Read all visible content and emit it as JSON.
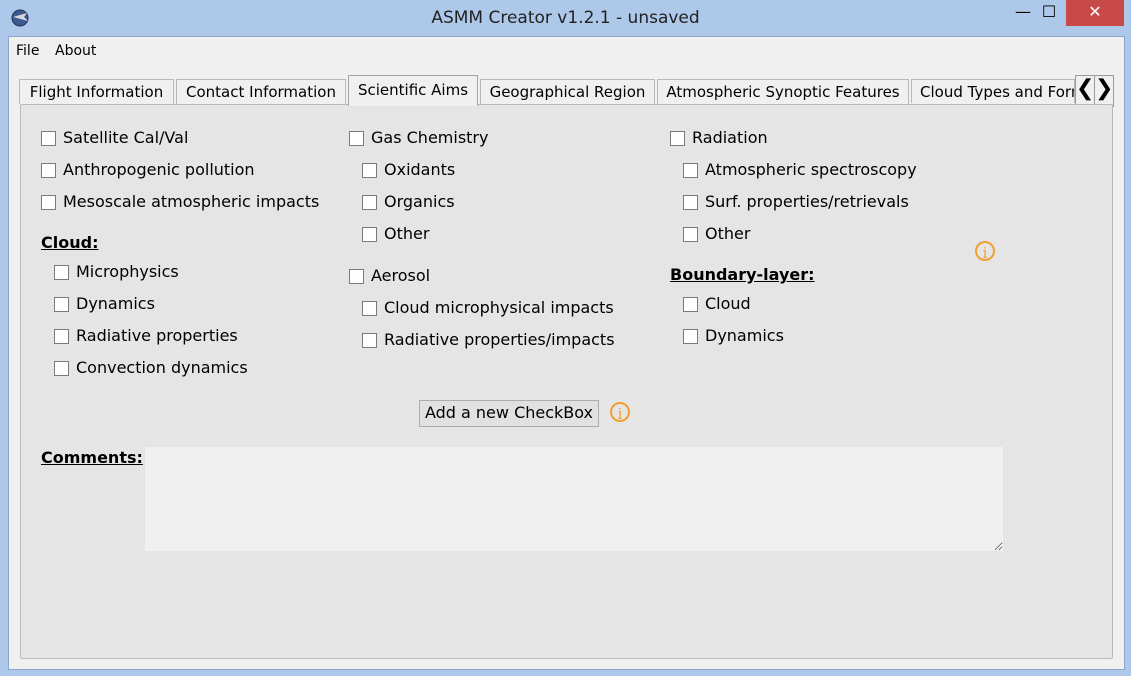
{
  "window": {
    "title": "ASMM Creator v1.2.1 - unsaved",
    "minimize": "—",
    "maximize": "☐",
    "close": "✕"
  },
  "menu": {
    "file": "File",
    "about": "About"
  },
  "tabs": [
    {
      "label": "Flight Information",
      "active": false
    },
    {
      "label": "Contact Information",
      "active": false
    },
    {
      "label": "Scientific Aims",
      "active": true
    },
    {
      "label": "Geographical Region",
      "active": false
    },
    {
      "label": "Atmospheric Synoptic Features",
      "active": false
    },
    {
      "label": "Cloud Types and Forms",
      "active": false
    }
  ],
  "tab_scroll": {
    "left": "❮",
    "right": "❯"
  },
  "col1": {
    "items": [
      "Satellite Cal/Val",
      "Anthropogenic pollution",
      "Mesoscale atmospheric impacts"
    ],
    "cloud_heading": "Cloud:",
    "cloud_items": [
      "Microphysics",
      "Dynamics",
      "Radiative properties",
      "Convection dynamics"
    ]
  },
  "col2": {
    "gas": "Gas Chemistry",
    "gas_items": [
      "Oxidants",
      "Organics",
      "Other"
    ],
    "aerosol": "Aerosol",
    "aerosol_items": [
      "Cloud microphysical impacts",
      "Radiative properties/impacts"
    ]
  },
  "col3": {
    "radiation": "Radiation",
    "radiation_items": [
      "Atmospheric spectroscopy",
      "Surf. properties/retrievals",
      "Other"
    ],
    "boundary_heading": "Boundary-layer:",
    "boundary_items": [
      "Cloud",
      "Dynamics"
    ]
  },
  "add_button": "Add a new CheckBox",
  "info_icon": "i",
  "comments_label": "Comments:",
  "comments_value": "",
  "colors": {
    "accent_info": "#f0a030",
    "close": "#c74a49",
    "titlebar": "#aec8ea"
  }
}
